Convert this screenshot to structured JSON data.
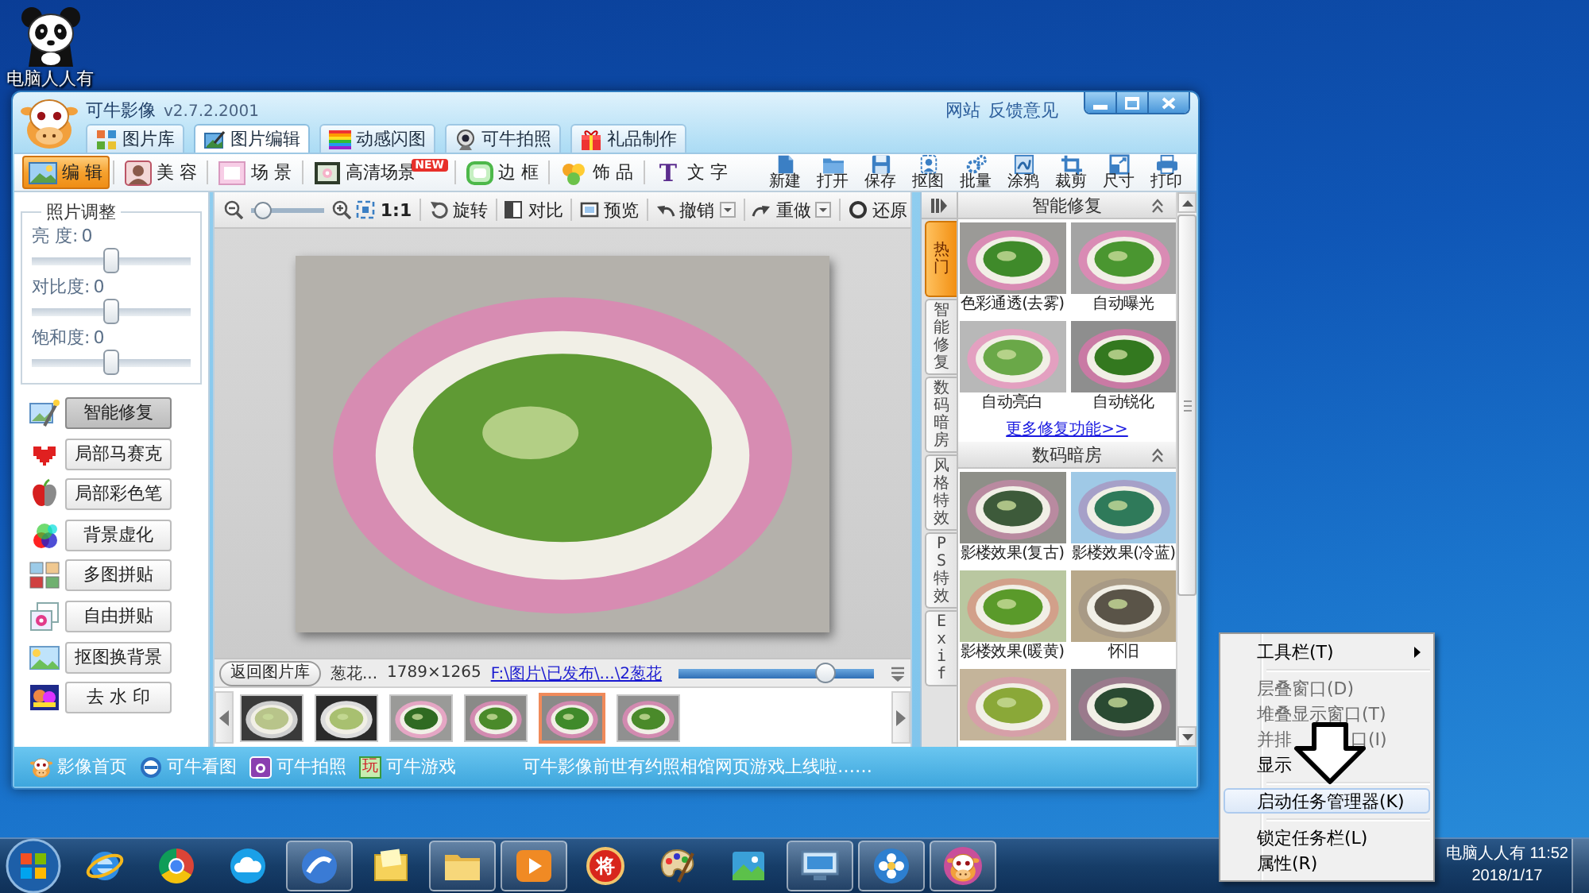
{
  "desktop": {
    "icon_label": "电脑人人有"
  },
  "window": {
    "app_name": "可牛影像",
    "version": "v2.7.2.2001",
    "links": [
      "网站",
      "反馈意见"
    ],
    "tabs": [
      {
        "label": "图片库",
        "selected": false
      },
      {
        "label": "图片编辑",
        "selected": true
      },
      {
        "label": "动感闪图",
        "selected": false
      },
      {
        "label": "可牛拍照",
        "selected": false
      },
      {
        "label": "礼品制作",
        "selected": false
      }
    ]
  },
  "toolbar": {
    "modes": [
      {
        "label": "编 辑",
        "selected": true
      },
      {
        "label": "美 容",
        "selected": false
      },
      {
        "label": "场 景",
        "selected": false
      },
      {
        "label": "高清场景",
        "selected": false,
        "badge": "NEW"
      },
      {
        "label": "边 框",
        "selected": false
      },
      {
        "label": "饰 品",
        "selected": false
      },
      {
        "label": "文 字",
        "selected": false,
        "glyph": "T"
      }
    ],
    "actions": [
      "新建",
      "打开",
      "保存",
      "抠图",
      "批量",
      "涂鸦",
      "裁剪",
      "尺寸",
      "打印"
    ]
  },
  "adjust_panel": {
    "title": "照片调整",
    "sliders": [
      {
        "label": "亮 度:",
        "value": "0",
        "level": 0.5
      },
      {
        "label": "对比度:",
        "value": "0",
        "level": 0.5
      },
      {
        "label": "饱和度:",
        "value": "0",
        "level": 0.5
      }
    ]
  },
  "tools": [
    {
      "label": "智能修复",
      "selected": true
    },
    {
      "label": "局部马赛克",
      "selected": false
    },
    {
      "label": "局部彩色笔",
      "selected": false
    },
    {
      "label": "背景虚化",
      "selected": false
    },
    {
      "label": "多图拼贴",
      "selected": false
    },
    {
      "label": "自由拼贴",
      "selected": false
    },
    {
      "label": "抠图换背景",
      "selected": false
    },
    {
      "label": "去 水 印",
      "selected": false
    }
  ],
  "view_toolbar": {
    "zoom_slider": {
      "level": 0.05
    },
    "actual_size": "1:1",
    "buttons": [
      {
        "label": "旋转",
        "dropdown": false
      },
      {
        "label": "对比",
        "dropdown": false
      },
      {
        "label": "预览",
        "dropdown": false
      },
      {
        "label": "撤销",
        "dropdown": true
      },
      {
        "label": "重做",
        "dropdown": true
      },
      {
        "label": "还原",
        "dropdown": false
      }
    ]
  },
  "info_bar": {
    "back_button": "返回图片库",
    "file_name": "葱花...",
    "dimensions": "1789×1265",
    "path": "F:\\图片\\已发布\\...\\2葱花",
    "slider": {
      "level": 0.78
    }
  },
  "filmstrip": {
    "thumbnails": [
      {
        "selected": false
      },
      {
        "selected": false
      },
      {
        "selected": false
      },
      {
        "selected": false
      },
      {
        "selected": true
      },
      {
        "selected": false
      }
    ]
  },
  "side_tabs": [
    {
      "label": "热门",
      "selected": true
    },
    {
      "label": "智能修复",
      "selected": false
    },
    {
      "label": "数码暗房",
      "selected": false
    },
    {
      "label": "风格特效",
      "selected": false
    },
    {
      "label": "PS特效",
      "selected": false
    },
    {
      "label": "Exif",
      "selected": false
    }
  ],
  "effect_sections": [
    {
      "title": "智能修复",
      "expanded": true,
      "tiles": [
        {
          "kind": "labeled",
          "label": "色彩通透(去雾)"
        },
        {
          "kind": "labeled",
          "label": "自动曝光"
        },
        {
          "kind": "labeled",
          "label": "自动亮白"
        },
        {
          "kind": "labeled",
          "label": "自动锐化"
        }
      ],
      "more_link": "更多修复功能>>"
    },
    {
      "title": "数码暗房",
      "expanded": true,
      "tiles": [
        {
          "kind": "labeled",
          "label": "影楼效果(复古)"
        },
        {
          "kind": "labeled",
          "label": "影楼效果(冷蓝)"
        },
        {
          "kind": "labeled",
          "label": "影楼效果(暖黄)"
        },
        {
          "kind": "labeled",
          "label": "怀旧"
        },
        {
          "kind": "unlabeled"
        },
        {
          "kind": "unlabeled"
        }
      ]
    }
  ],
  "status_bar": {
    "links": [
      {
        "label": "影像首页"
      },
      {
        "label": "可牛看图"
      },
      {
        "label": "可牛拍照"
      },
      {
        "label": "可牛游戏",
        "glyph": "玩"
      }
    ],
    "notice": "可牛影像前世有约照相馆网页游戏上线啦……"
  },
  "taskbar": {
    "apps": [
      {
        "running": false
      },
      {
        "running": false
      },
      {
        "running": false
      },
      {
        "running": true
      },
      {
        "running": false
      },
      {
        "running": true
      },
      {
        "running": true
      },
      {
        "running": false,
        "glyph": "将"
      },
      {
        "running": false
      },
      {
        "running": false
      },
      {
        "running": true
      },
      {
        "running": true
      },
      {
        "running": true
      }
    ],
    "clock": {
      "time": "电脑人人有 11:52",
      "date": "2018/1/17"
    }
  },
  "context_menu": {
    "items": [
      {
        "kind": "submenu",
        "label": "工具栏(T)",
        "disabled": false,
        "selected": false
      },
      {
        "kind": "separator"
      },
      {
        "kind": "command",
        "label": "层叠窗口(D)",
        "disabled": true,
        "selected": false
      },
      {
        "kind": "command",
        "label": "堆叠显示窗口(T)",
        "disabled": true,
        "selected": false
      },
      {
        "kind": "command",
        "label": "并排",
        "tail": "口(I)",
        "disabled": true,
        "selected": false
      },
      {
        "kind": "command",
        "label": "显示",
        "disabled": false,
        "selected": false
      },
      {
        "kind": "separator"
      },
      {
        "kind": "command",
        "label": "启动任务管理器(K)",
        "disabled": false,
        "selected": true
      },
      {
        "kind": "separator"
      },
      {
        "kind": "command",
        "label": "锁定任务栏(L)",
        "disabled": false,
        "selected": false
      },
      {
        "kind": "command",
        "label": "属性(R)",
        "disabled": false,
        "selected": false
      }
    ]
  }
}
